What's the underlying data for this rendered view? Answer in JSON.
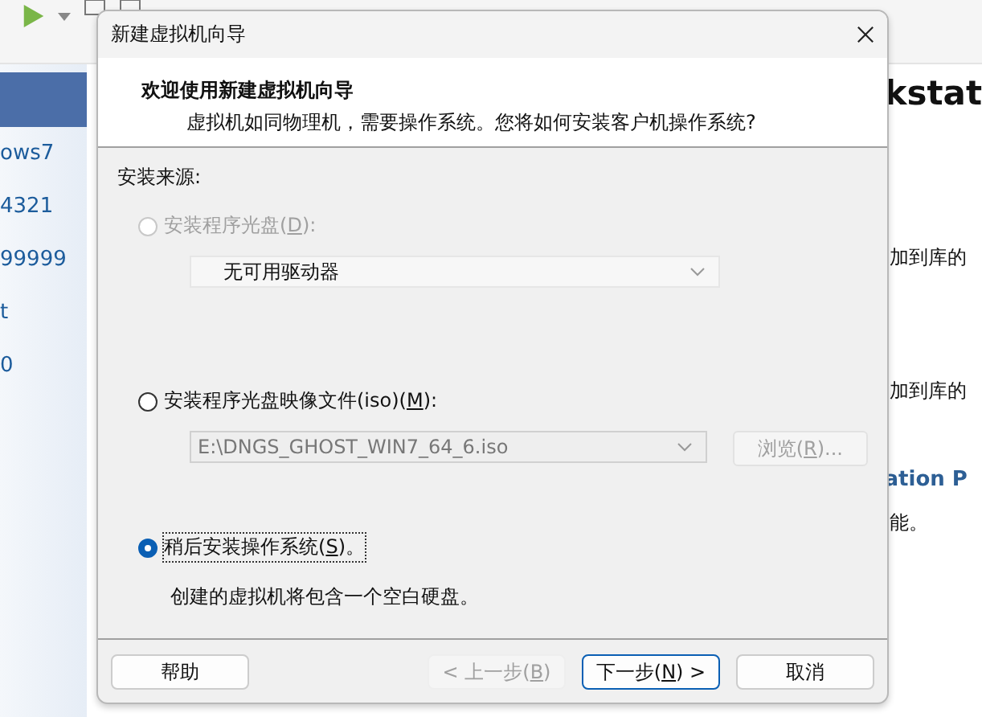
{
  "background": {
    "sidebar_items": [
      {
        "label": "ows7"
      },
      {
        "label": "4321"
      },
      {
        "label": "99999"
      },
      {
        "label": "t"
      },
      {
        "label": "0"
      }
    ],
    "content": [
      {
        "kind": "title",
        "text": "kstat"
      },
      {
        "kind": "body",
        "text": "加到库的"
      },
      {
        "kind": "body",
        "text": "加到库的"
      },
      {
        "kind": "heading",
        "text": "ation P"
      },
      {
        "kind": "body",
        "text": "能。"
      }
    ]
  },
  "dialog": {
    "title": "新建虚拟机向导",
    "heading": "欢迎使用新建虚拟机向导",
    "subtitle": "虚拟机如同物理机，需要操作系统。您将如何安装客户机操作系统?",
    "section_label": "安装来源:",
    "options": [
      {
        "text_before": "安装程序光盘(",
        "access_key": "D",
        "text_after": "):",
        "selected": false,
        "disabled": true,
        "combo": {
          "value": "无可用驱动器",
          "disabled": true
        }
      },
      {
        "text_before": "安装程序光盘映像文件(iso)(",
        "access_key": "M",
        "text_after": "):",
        "selected": false,
        "disabled": false,
        "combo": {
          "value": "E:\\DNGS_GHOST_WIN7_64_6.iso",
          "disabled": true
        },
        "button": {
          "text_before": "浏览(",
          "access_key": "R",
          "text_after": ")...",
          "disabled": true
        }
      },
      {
        "text_before": "稍后安装操作系统(",
        "access_key": "S",
        "text_after": ")。",
        "selected": true,
        "disabled": false,
        "note": "创建的虚拟机将包含一个空白硬盘。"
      }
    ],
    "buttons": [
      {
        "kind": "left",
        "text_before": "帮助",
        "disabled": false,
        "default": false
      },
      {
        "kind": "right",
        "text_before": "< 上一步(",
        "access_key": "B",
        "text_after": ")",
        "disabled": true,
        "default": false
      },
      {
        "kind": "right",
        "text_before": "下一步(",
        "access_key": "N",
        "text_after": ") >",
        "disabled": false,
        "default": true
      },
      {
        "kind": "right",
        "text_before": "取消",
        "disabled": false,
        "default": false
      }
    ]
  }
}
